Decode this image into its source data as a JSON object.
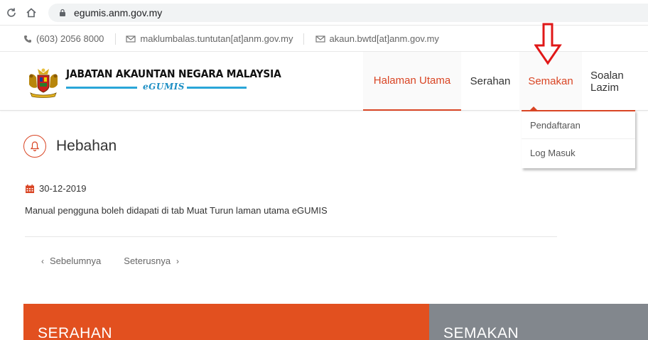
{
  "browser": {
    "url": "egumis.anm.gov.my"
  },
  "contact": {
    "phone": "(603) 2056 8000",
    "email1": "maklumbalas.tuntutan[at]anm.gov.my",
    "email2": "akaun.bwtd[at]anm.gov.my"
  },
  "logo": {
    "title": "JABATAN AKAUNTAN NEGARA MALAYSIA",
    "subtitle": "eGUMIS"
  },
  "menu": {
    "items": [
      {
        "label": "Halaman Utama"
      },
      {
        "label": "Serahan"
      },
      {
        "label": "Semakan"
      },
      {
        "label": "Soalan Lazim"
      }
    ]
  },
  "dropdown": {
    "items": [
      {
        "label": "Pendaftaran"
      },
      {
        "label": "Log Masuk"
      }
    ]
  },
  "content": {
    "heading": "Hebahan",
    "date": "30-12-2019",
    "body": "Manual pengguna boleh didapati di tab Muat Turun laman utama eGUMIS",
    "prev": "Sebelumnya",
    "next": "Seterusnya"
  },
  "panels": {
    "left": "SERAHAN",
    "right": "SEMAKAN"
  },
  "colors": {
    "accent": "#d94524",
    "panel_orange": "#e2501f",
    "panel_gray": "#82878d"
  }
}
